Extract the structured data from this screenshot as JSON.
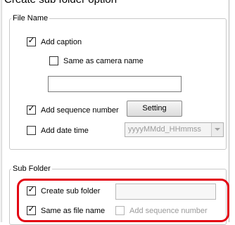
{
  "page_heading": "Create sub folder option",
  "file_name_group": {
    "title": "File Name",
    "add_caption": {
      "label": "Add caption",
      "checked": true
    },
    "same_as_camera_name": {
      "label": "Same as camera name",
      "checked": false
    },
    "caption_text": {
      "value": ""
    },
    "add_sequence_number": {
      "label": "Add sequence number",
      "checked": true
    },
    "setting_button": "Setting",
    "add_date_time": {
      "label": "Add date time",
      "checked": false
    },
    "date_format": {
      "value": "yyyyMMdd_HHmmss"
    }
  },
  "sub_folder_group": {
    "title": "Sub Folder",
    "create_sub_folder": {
      "label": "Create sub folder",
      "checked": true
    },
    "sub_folder_name": {
      "value": ""
    },
    "same_as_file_name": {
      "label": "Same as file name",
      "checked": true
    },
    "add_sequence_number": {
      "label": "Add sequence number",
      "checked": false
    }
  },
  "colors": {
    "highlight": "#e30613"
  },
  "glyphs": {
    "check": "✓"
  }
}
